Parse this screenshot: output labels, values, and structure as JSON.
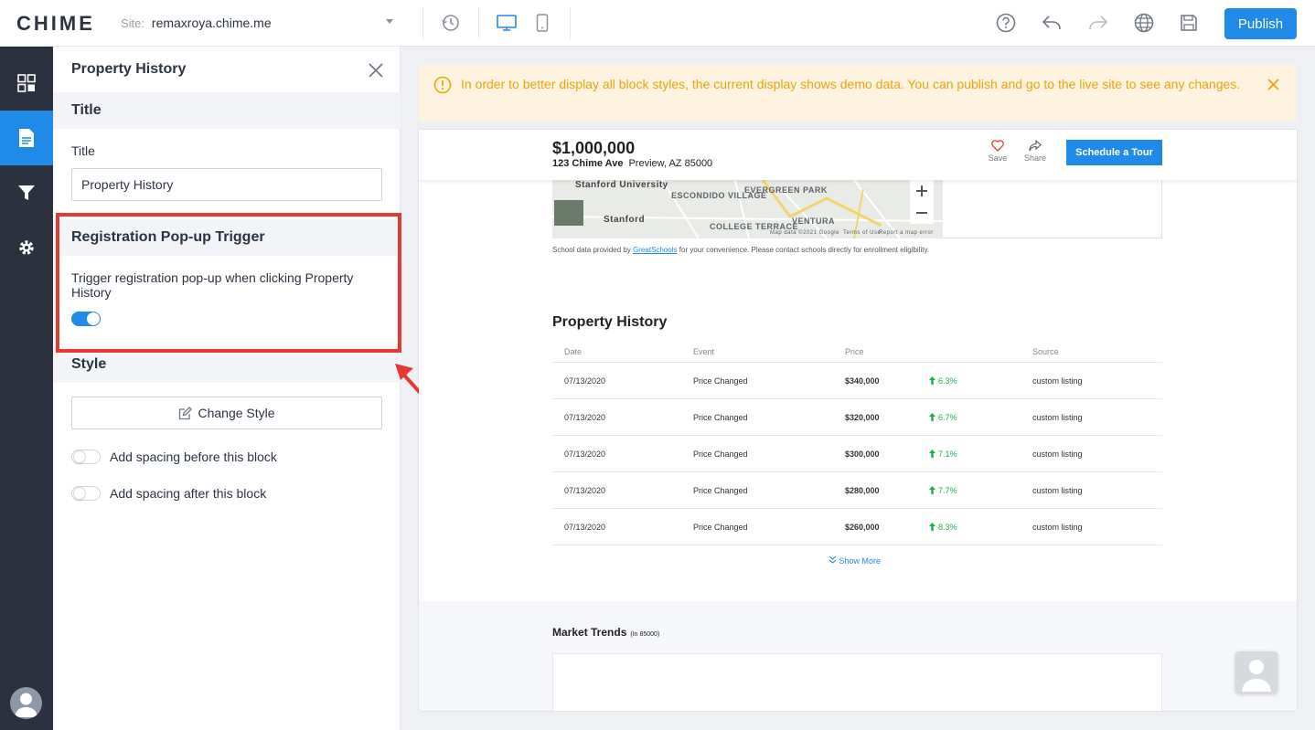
{
  "app": {
    "logo": "CHIME"
  },
  "topbar": {
    "site_label": "Site:",
    "site_value": "remaxroya.chime.me",
    "publish_label": "Publish",
    "icons": [
      "history-icon",
      "desktop-icon",
      "mobile-icon",
      "help-icon",
      "undo-icon",
      "redo-icon",
      "globe-icon",
      "save-icon"
    ]
  },
  "rail": {
    "items": [
      "dashboard-icon",
      "page-icon",
      "filter-icon",
      "settings-icon"
    ],
    "active": "page-icon"
  },
  "panel": {
    "title": "Property History",
    "title_section": {
      "header": "Title",
      "field_label": "Title",
      "field_value": "Property History"
    },
    "registration_section": {
      "header": "Registration Pop-up Trigger",
      "description": "Trigger registration pop-up when clicking Property History",
      "toggle_on": true
    },
    "style_section": {
      "header": "Style",
      "change_style_label": "Change Style",
      "spacing_before_label": "Add spacing before this block",
      "spacing_after_label": "Add spacing after this block"
    }
  },
  "notice": {
    "text": "In order to better display all block styles, the current display shows demo data. You can publish and go to the live site to see any changes.",
    "color": "#f2a20a"
  },
  "preview": {
    "price": "$1,000,000",
    "address_street": "123 Chime Ave",
    "address_city": "Preview, AZ 85000",
    "save_label": "Save",
    "share_label": "Share",
    "tour_label": "Schedule a Tour",
    "map": {
      "labels": [
        "Stanford University",
        "ESCONDIDO VILLAGE",
        "EVERGREEN PARK",
        "Stanford",
        "COLLEGE TERRACE",
        "VENTURA"
      ],
      "attribution": "Map data ©2021 Google",
      "terms": "Terms of Use",
      "report": "Report a map error"
    },
    "school_note_prefix": "School data provided by",
    "school_note_link": "GreatSchools",
    "school_note_suffix": "for your convenience. Please contact schools directly for enrollment eligibility.",
    "history": {
      "title": "Property History",
      "columns": [
        "Date",
        "Event",
        "Price",
        "Source"
      ],
      "rows": [
        {
          "date": "07/13/2020",
          "event": "Price Changed",
          "price": "$340,000",
          "change": "6.3%",
          "source": "custom listing"
        },
        {
          "date": "07/13/2020",
          "event": "Price Changed",
          "price": "$320,000",
          "change": "6.7%",
          "source": "custom listing"
        },
        {
          "date": "07/13/2020",
          "event": "Price Changed",
          "price": "$300,000",
          "change": "7.1%",
          "source": "custom listing"
        },
        {
          "date": "07/13/2020",
          "event": "Price Changed",
          "price": "$280,000",
          "change": "7.7%",
          "source": "custom listing"
        },
        {
          "date": "07/13/2020",
          "event": "Price Changed",
          "price": "$260,000",
          "change": "8.3%",
          "source": "custom listing"
        }
      ],
      "show_more": "Show More"
    },
    "market": {
      "title": "Market Trends",
      "subtitle": "(In 85000)"
    }
  },
  "colors": {
    "accent": "#1f8ae8",
    "rail_bg": "#2c3140",
    "highlight": "#e53a34",
    "positive": "#1aae4b"
  }
}
